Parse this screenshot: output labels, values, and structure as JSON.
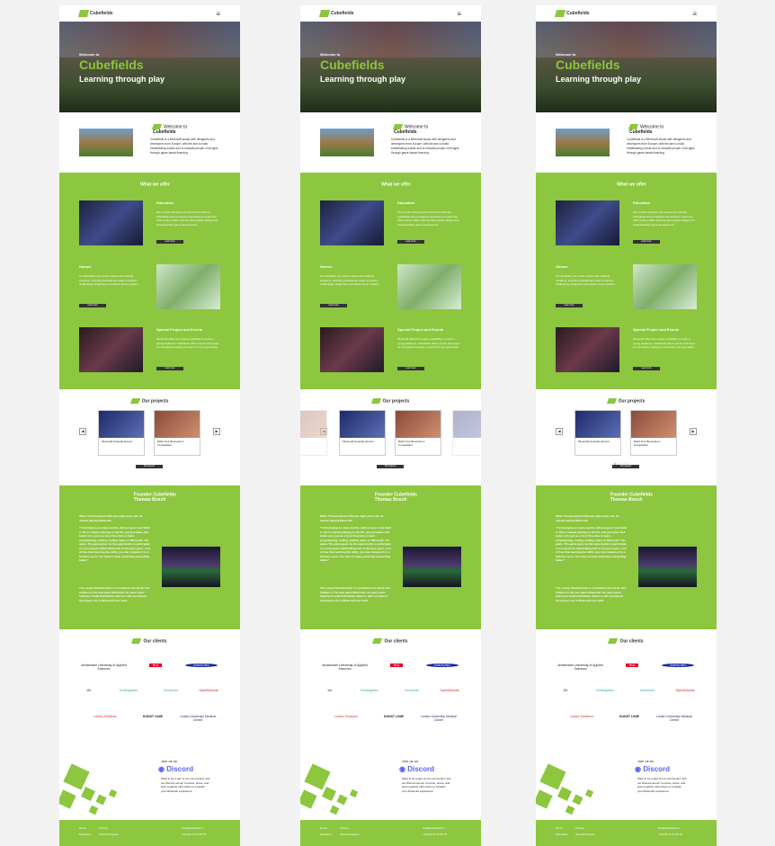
{
  "nav": {
    "logo": "Cubefields",
    "menu_icon": "hamburger-icon"
  },
  "hero": {
    "welcome": "Welcome to",
    "title": "Cubefields",
    "tagline": "Learning through play"
  },
  "intro": {
    "welcome": "Welcome to",
    "name": "Cubefields",
    "text": "Cubefields is a Minecraft studio with designers and developers from Europe, with the aim to build breathtaking worlds and to educate people of all ages through game-based learning."
  },
  "offer": {
    "title": "What we offer",
    "items": [
      {
        "head": "Education",
        "text": "We provide trainings and courses for schools, individuals and companies focussing on improving 21th century skills, learning about game design and understanding game development.",
        "btn": "read more"
      },
      {
        "head": "Games",
        "text": "At Cubefields, we create unique and inspiring creations, including educational maps to explore, challenging minigames and stylish server spawns.",
        "btn": "read more"
      },
      {
        "head": "Special Project and Events",
        "text": "Minecraft offers the unique possibility to reach a young audience. Cubefields offers events and maps for companies wanting to reach the next generation.",
        "btn": "read more"
      }
    ]
  },
  "projects": {
    "title": "Our projects",
    "cards": [
      "Minecraft Hospital Heroes",
      "Build Your Benneleum Competition"
    ],
    "all_btn": "All projects"
  },
  "founder": {
    "title_line1": "Founder Cubefields",
    "title_line2": "Thomas Bosch",
    "p1": "When Thomas Bosch (30) was eight years old, he started playing Minecraft.",
    "p2": "\"I find playing so many worlds, without goal, I just liked it. Then I started playing on the PC, and got better and better at it, just as a lot of free time to learn programming, coding, making maps on Minecraft. The game. The game gave me the opportunity to participate in cool projects within Minecraft. In the past years, a lot of free time learning the skills, you can compare it to a full-time sport. You have to keep practicing and getting better.\"",
    "p3": "The young Teltamberaner is committed now all his free hobbies in the new game Minecraft. He spent years helping to build Cubefields, which is still considered the largest city in Minecraft ever built."
  },
  "clients": {
    "title": "Our clients",
    "logos": [
      "Amsterdam University of Applied Sciences",
      "HvA",
      "SAMSUNG",
      "i2e",
      "Kindergarten",
      "Kennisnet",
      "OpenSchools",
      "Leiden Kinderen",
      "KUNST LINIE",
      "Leiden University Medical Centre"
    ]
  },
  "discord": {
    "head": "Join us on",
    "logo": "Discord",
    "text": "Want to be a part of our community? Join our Discord server! Connect, share, and learn together with others to broaden your Minecraft experience."
  },
  "footer": {
    "c1": "Home",
    "c2": "Privacy",
    "c3": "info@cubefields.nl",
    "c4": "Education",
    "c5": "Special Projects",
    "c6": "+31(0)6 12 34 56 78"
  }
}
